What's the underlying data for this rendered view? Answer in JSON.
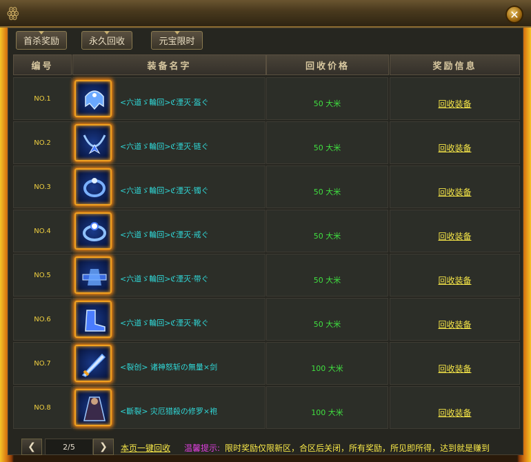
{
  "window": {
    "ornament": "ꙮ",
    "close_glyph": "✕"
  },
  "tabs": [
    {
      "label": "首杀奖励"
    },
    {
      "label": "永久回收"
    },
    {
      "label": "元宝限时"
    }
  ],
  "table": {
    "columns": [
      "编号",
      "装备名字",
      "回收价格",
      "奖励信息"
    ],
    "rows": [
      {
        "no": "NO.1",
        "name": "<六道ゞ輪回>ℭ湮灭·盔ぐ",
        "price": "50 大米",
        "action": "回收装备",
        "icon": "helmet-icon"
      },
      {
        "no": "NO.2",
        "name": "<六道ゞ輪回>ℭ湮灭·链ぐ",
        "price": "50 大米",
        "action": "回收装备",
        "icon": "necklace-icon"
      },
      {
        "no": "NO.3",
        "name": "<六道ゞ輪回>ℭ湮灭·镯ぐ",
        "price": "50 大米",
        "action": "回收装备",
        "icon": "bracelet-icon"
      },
      {
        "no": "NO.4",
        "name": "<六道ゞ輪回>ℭ湮灭·戒ぐ",
        "price": "50 大米",
        "action": "回收装备",
        "icon": "ring-icon"
      },
      {
        "no": "NO.5",
        "name": "<六道ゞ輪回>ℭ湮灭·带ぐ",
        "price": "50 大米",
        "action": "回收装备",
        "icon": "belt-icon"
      },
      {
        "no": "NO.6",
        "name": "<六道ゞ輪回>ℭ湮灭·靴ぐ",
        "price": "50 大米",
        "action": "回收装备",
        "icon": "boots-icon"
      },
      {
        "no": "NO.7",
        "name": "<裂创> 诸神怒斩の無量×剑",
        "price": "100 大米",
        "action": "回收装备",
        "icon": "sword-icon"
      },
      {
        "no": "NO.8",
        "name": "<斷裂> 灾厄猎殺の修罗×袍",
        "price": "100 大米",
        "action": "回收装备",
        "icon": "robe-icon"
      }
    ]
  },
  "footer": {
    "prev_glyph": "❮",
    "next_glyph": "❯",
    "page": "2/5",
    "recycle_all": "本页一键回收",
    "hint_label": "温馨提示:",
    "hint_text": "限时奖励仅限新区，合区后关闭，所有奖励，所见即所得，达到就是赚到"
  },
  "colors": {
    "accent_gold": "#f8e848",
    "item_name": "#30d8d8",
    "price_green": "#40e040",
    "hint_magenta": "#e040e0"
  }
}
